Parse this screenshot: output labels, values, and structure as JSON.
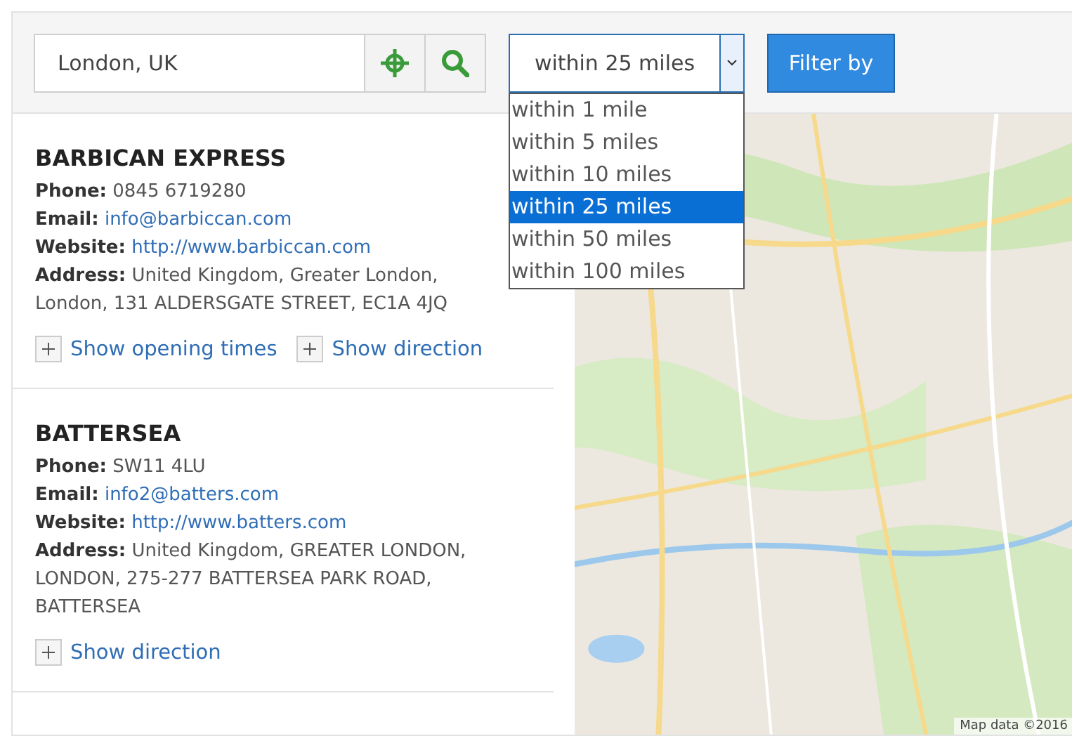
{
  "search": {
    "value": "London, UK"
  },
  "radius": {
    "value": "within 25 miles",
    "expanded": true,
    "options": [
      {
        "label": "within 1 mile",
        "selected": false
      },
      {
        "label": "within 5 miles",
        "selected": false
      },
      {
        "label": "within 10 miles",
        "selected": false
      },
      {
        "label": "within 25 miles",
        "selected": true
      },
      {
        "label": "within 50 miles",
        "selected": false
      },
      {
        "label": "within 100 miles",
        "selected": false
      }
    ]
  },
  "filter_button": "Filter by",
  "stores": [
    {
      "name": "BARBICAN EXPRESS",
      "fields": [
        {
          "label": "Phone:",
          "value": "0845 6719280",
          "kind": "text"
        },
        {
          "label": "Email:",
          "value": "info@barbiccan.com",
          "kind": "link"
        },
        {
          "label": "Website:",
          "value": "http://www.barbiccan.com",
          "kind": "link"
        },
        {
          "label": "Address:",
          "value": "United Kingdom, Greater London, London, 131 ALDERSGATE STREET, EC1A 4JQ",
          "kind": "text"
        }
      ],
      "actions": [
        "Show opening times",
        "Show direction"
      ]
    },
    {
      "name": "BATTERSEA",
      "fields": [
        {
          "label": "Phone:",
          "value": "SW11 4LU",
          "kind": "text"
        },
        {
          "label": "Email:",
          "value": "info2@batters.com",
          "kind": "link"
        },
        {
          "label": "Website:",
          "value": "http://www.batters.com",
          "kind": "link"
        },
        {
          "label": "Address:",
          "value": "United Kingdom, GREATER LONDON, LONDON, 275-277 BATTERSEA PARK ROAD, BATTERSEA",
          "kind": "text"
        }
      ],
      "actions": [
        "Show direction"
      ]
    }
  ],
  "map": {
    "kind": "picture",
    "attribution": "Map data ©2016"
  }
}
